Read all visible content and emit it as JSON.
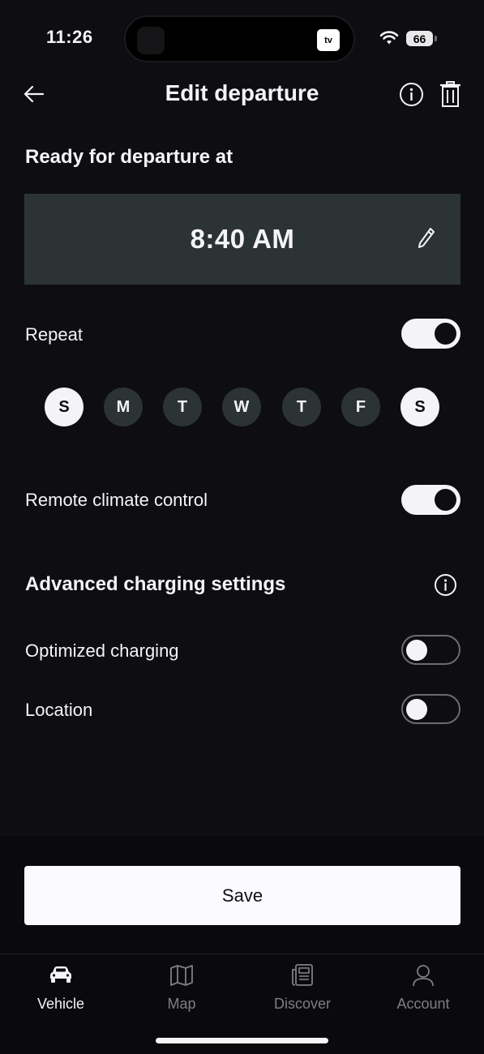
{
  "status_bar": {
    "time": "11:26",
    "live_activity": "tv",
    "battery": "66"
  },
  "header": {
    "title": "Edit departure",
    "back_icon": "arrow-left-icon",
    "info_icon": "info-icon",
    "delete_icon": "trash-icon"
  },
  "departure": {
    "heading": "Ready for departure at",
    "time": "8:40 AM",
    "edit_icon": "pencil-icon"
  },
  "repeat": {
    "label": "Repeat",
    "enabled": true,
    "days": [
      {
        "label": "S",
        "selected": true
      },
      {
        "label": "M",
        "selected": false
      },
      {
        "label": "T",
        "selected": false
      },
      {
        "label": "W",
        "selected": false
      },
      {
        "label": "T",
        "selected": false
      },
      {
        "label": "F",
        "selected": false
      },
      {
        "label": "S",
        "selected": true
      }
    ]
  },
  "climate": {
    "label": "Remote climate control",
    "enabled": true
  },
  "advanced": {
    "heading": "Advanced charging settings",
    "info_icon": "info-icon",
    "optimized_charging": {
      "label": "Optimized charging",
      "enabled": false
    },
    "location": {
      "label": "Location",
      "enabled": false
    }
  },
  "save_label": "Save",
  "tabs": [
    {
      "label": "Vehicle",
      "icon": "car-icon",
      "active": true
    },
    {
      "label": "Map",
      "icon": "map-icon",
      "active": false
    },
    {
      "label": "Discover",
      "icon": "newspaper-icon",
      "active": false
    },
    {
      "label": "Account",
      "icon": "user-icon",
      "active": false
    }
  ],
  "colors": {
    "background": "#0e0e12",
    "card": "#2c3335",
    "foreground": "#f4f4f6",
    "inactive": "#7e7e84"
  }
}
